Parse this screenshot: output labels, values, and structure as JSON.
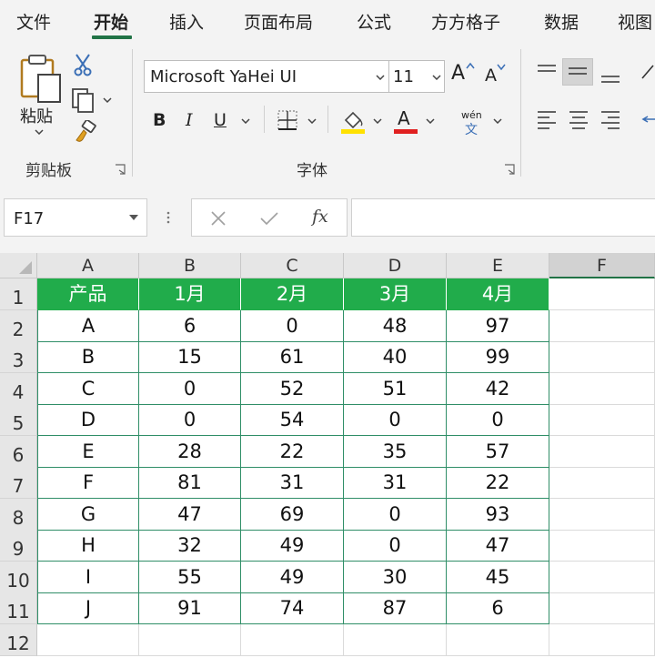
{
  "menu": {
    "tabs": [
      "文件",
      "开始",
      "插入",
      "页面布局",
      "公式",
      "方方格子",
      "数据",
      "视图"
    ],
    "active_tab": "开始"
  },
  "ribbon": {
    "clipboard": {
      "paste_label": "粘贴",
      "group_label": "剪贴板"
    },
    "font": {
      "font_name": "Microsoft YaHei UI",
      "font_size": "11",
      "grow_label": "A",
      "shrink_label": "A",
      "bold_label": "B",
      "italic_label": "I",
      "underline_label": "U",
      "font_color_label": "A",
      "phonetic_top": "wén",
      "phonetic_bottom": "文",
      "group_label": "字体",
      "fill_color": "#ffe100",
      "font_color": "#e02020"
    }
  },
  "formula_bar": {
    "name_box": "F17",
    "fx_label": "fx",
    "formula": ""
  },
  "sheet": {
    "columns": [
      "A",
      "B",
      "C",
      "D",
      "E",
      "F"
    ],
    "selected_column": "F",
    "row_numbers": [
      "1",
      "2",
      "3",
      "4",
      "5",
      "6",
      "7",
      "8",
      "9",
      "10",
      "11",
      "12"
    ],
    "header_row": [
      "产品",
      "1月",
      "2月",
      "3月",
      "4月"
    ],
    "rows": [
      [
        "A",
        "6",
        "0",
        "48",
        "97"
      ],
      [
        "B",
        "15",
        "61",
        "40",
        "99"
      ],
      [
        "C",
        "0",
        "52",
        "51",
        "42"
      ],
      [
        "D",
        "0",
        "54",
        "0",
        "0"
      ],
      [
        "E",
        "28",
        "22",
        "35",
        "57"
      ],
      [
        "F",
        "81",
        "31",
        "31",
        "22"
      ],
      [
        "G",
        "47",
        "69",
        "0",
        "93"
      ],
      [
        "H",
        "32",
        "49",
        "0",
        "47"
      ],
      [
        "I",
        "55",
        "49",
        "30",
        "45"
      ],
      [
        "J",
        "91",
        "74",
        "87",
        "6"
      ]
    ],
    "header_fill": "#21ac4b",
    "border_color": "#2f8e67"
  }
}
